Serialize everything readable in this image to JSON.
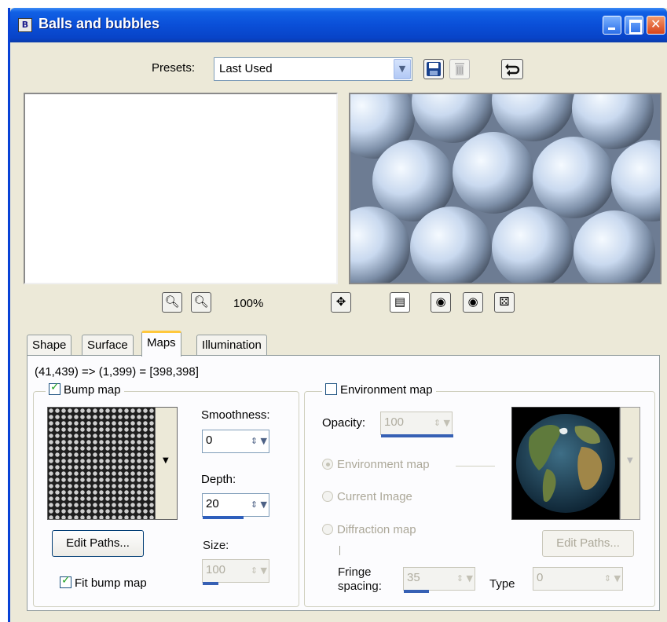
{
  "window": {
    "title": "Balls and bubbles",
    "app_icon_letter": "B"
  },
  "presets": {
    "label": "Presets:",
    "selected": "Last Used"
  },
  "zoom": {
    "level": "100%"
  },
  "tabs": [
    {
      "label": "Shape",
      "active": false
    },
    {
      "label": "Surface",
      "active": false
    },
    {
      "label": "Maps",
      "active": true
    },
    {
      "label": "Illumination",
      "active": false
    }
  ],
  "maps": {
    "coords_text": "(41,439) => (1,399) = [398,398]",
    "bump_map": {
      "label": "Bump map",
      "checked": true,
      "smoothness_label": "Smoothness:",
      "smoothness_value": "0",
      "depth_label": "Depth:",
      "depth_value": "20",
      "size_label": "Size:",
      "size_value": "100",
      "edit_paths_label": "Edit Paths...",
      "fit_label": "Fit bump map",
      "fit_checked": true
    },
    "environment_map": {
      "label": "Environment map",
      "checked": false,
      "opacity_label": "Opacity:",
      "opacity_value": "100",
      "options": [
        "Environment map",
        "Current Image",
        "Diffraction map"
      ],
      "selected_option": "Environment map",
      "edit_paths_label": "Edit Paths...",
      "fringe_label_1": "Fringe",
      "fringe_label_2": "spacing:",
      "fringe_value": "35",
      "type_label": "Type",
      "type_value": "0"
    }
  },
  "colors": {
    "title_bar": "#0a4fd8",
    "dialog_bg": "#ece9d8",
    "active_tab_accent": "#ffc83c",
    "spin_fill": "#2e5fbc"
  }
}
